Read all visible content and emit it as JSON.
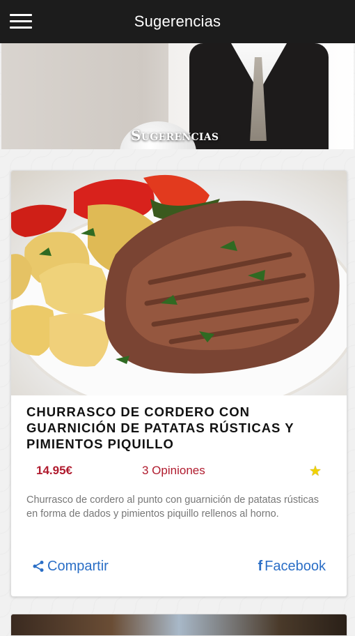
{
  "topbar": {
    "title": "Sugerencias",
    "menu_icon": "hamburger-icon"
  },
  "hero": {
    "label": "Sugerencias"
  },
  "item": {
    "title": "CHURRASCO DE CORDERO CON GUARNICIÓN DE PATATAS RÚSTICAS Y PIMIENTOS PIQUILLO",
    "price": "14.95€",
    "opinions": "3 Opiniones",
    "star_icon": "star-icon",
    "description": "Churrasco de cordero al punto con guarnición de patatas rústicas en forma de dados y pimientos piquillo rellenos al horno.",
    "share_label": "Compartir",
    "share_icon": "share-icon",
    "facebook_label": "Facebook",
    "facebook_icon": "facebook-icon"
  },
  "colors": {
    "topbar": "#1c1c1c",
    "accent_red": "#b01b2e",
    "link_blue": "#2a6ec6",
    "star_yellow": "#f1d200"
  }
}
